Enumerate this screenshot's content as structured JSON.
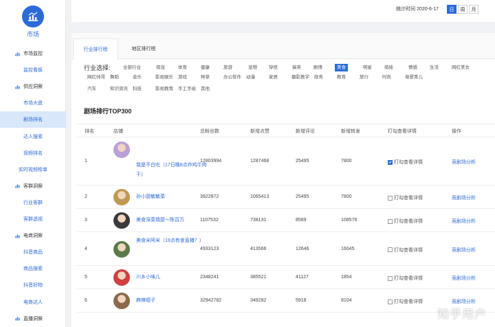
{
  "sidebar": {
    "title": "市场",
    "items": [
      {
        "label": "市场监控",
        "type": "group"
      },
      {
        "label": "监控看板",
        "type": "sub"
      },
      {
        "label": "供应洞察",
        "type": "group"
      },
      {
        "label": "市场大盘",
        "type": "sub"
      },
      {
        "label": "剧场排名",
        "type": "sub",
        "active": true
      },
      {
        "label": "达人搜索",
        "type": "sub"
      },
      {
        "label": "视频排名",
        "type": "sub"
      },
      {
        "label": "实时视频榜单",
        "type": "sub"
      },
      {
        "label": "客群洞察",
        "type": "group"
      },
      {
        "label": "行业客群",
        "type": "sub"
      },
      {
        "label": "客群透视",
        "type": "sub"
      },
      {
        "label": "电商洞察",
        "type": "group"
      },
      {
        "label": "抖音商品",
        "type": "sub"
      },
      {
        "label": "商品搜索",
        "type": "sub"
      },
      {
        "label": "抖音好物",
        "type": "sub"
      },
      {
        "label": "电商达人",
        "type": "sub"
      },
      {
        "label": "直播洞察",
        "type": "group"
      }
    ]
  },
  "topbar": {
    "stat_time": "统计时间 2020-6-17",
    "granularity": [
      "日",
      "周",
      "月"
    ],
    "active_granularity": "日"
  },
  "tabs": [
    "行业排行榜",
    "地区排行榜"
  ],
  "category_label": "行业选择:",
  "categories": [
    [
      "全部行业",
      "萌宠",
      "体育",
      "健康",
      "旅游",
      "宠物",
      "穿搭",
      "搞笑",
      "剧情",
      "美食",
      "明星",
      "萌娃",
      "情感",
      "生活",
      "网红美女"
    ],
    [
      "网红帅哥",
      "舞蹈",
      "音乐",
      "影视娱乐",
      "游戏",
      "种草",
      "办公软件",
      "动漫",
      "家居",
      "摄影教学",
      "政务",
      "教育",
      "旅行",
      "时尚",
      "母婴育儿"
    ],
    [
      "汽车",
      "知识资讯",
      "科技",
      "影视教育",
      "手工手绘",
      "其他"
    ]
  ],
  "active_category": "美食",
  "list_title": "剧场排行TOP300",
  "table": {
    "headers": [
      "排名",
      "店铺",
      "总粉丝数",
      "新增点赞",
      "新增评论",
      "新增转发",
      "打勾查看详情",
      "操作"
    ],
    "rows": [
      {
        "rank": "1",
        "shop": "我是不白吃（17日晚8点炸鸡牛肉干）",
        "fans": "12803994",
        "likes": "1287468",
        "comments": "25495",
        "shares": "7800",
        "check": "打勾查看详情",
        "checked": true,
        "op": "竞剧场分析"
      },
      {
        "rank": "2",
        "shop": "孙小厨敏敏菜",
        "fans": "3922872",
        "likes": "1065413",
        "comments": "25495",
        "shares": "7800",
        "check": "打勾查看详情",
        "checked": false,
        "op": "竞剧场分析"
      },
      {
        "rank": "3",
        "shop": "美食深菜情厨～陈百万",
        "fans": "1107532",
        "likes": "738131",
        "comments": "8589",
        "shares": "108576",
        "check": "打勾查看详情",
        "checked": false,
        "op": "竞剧场分析"
      },
      {
        "rank": "4",
        "shop": "美食米阿米（19点有食直播？）",
        "fans": "4933123",
        "likes": "413566",
        "comments": "12646",
        "shares": "16045",
        "check": "打勾查看详情",
        "checked": false,
        "op": "竞剧场分析"
      },
      {
        "rank": "5",
        "shop": "川乡小味儿",
        "fans": "2348241",
        "likes": "385521",
        "comments": "41127",
        "shares": "1854",
        "check": "打勾查看详情",
        "checked": false,
        "op": "竞剧场分析"
      },
      {
        "rank": "6",
        "shop": "麻辣德子",
        "fans": "32942782",
        "likes": "349282",
        "comments": "5918",
        "shares": "8104",
        "check": "打勾查看详情",
        "checked": false,
        "op": "竞剧场分析"
      }
    ]
  },
  "watermark": "知乎用户",
  "colors": {
    "accent": "#2b6ad8",
    "active_bg": "#d9e7fb"
  }
}
